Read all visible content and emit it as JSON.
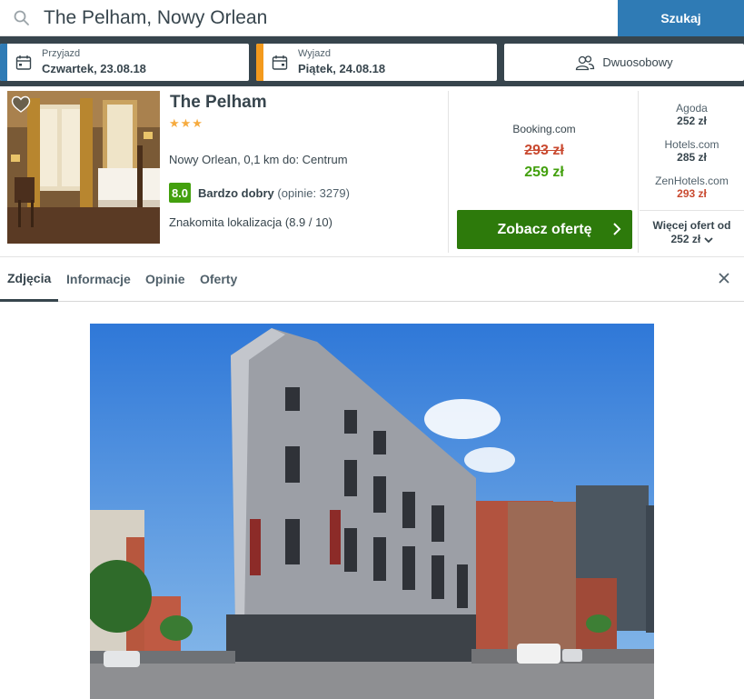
{
  "search": {
    "value": "The Pelham, Nowy Orlean",
    "button_label": "Szukaj"
  },
  "dates": {
    "checkin": {
      "label": "Przyjazd",
      "value": "Czwartek, 23.08.18",
      "accent": "#2f7bb5"
    },
    "checkout": {
      "label": "Wyjazd",
      "value": "Piątek, 24.08.18",
      "accent": "#f39a1d"
    },
    "rooms": {
      "label": "Dwuosobowy",
      "icon": "guests-icon"
    }
  },
  "hotel": {
    "name": "The Pelham",
    "stars": "★★★",
    "location": "Nowy Orlean, 0,1 km do: Centrum",
    "rating": {
      "score": "8.0",
      "label": "Bardzo dobry",
      "reviews": "(opinie: 3279)"
    },
    "location_score": "Znakomita lokalizacja (8.9 / 10)",
    "favorite_icon": "heart-icon"
  },
  "deal": {
    "provider": "Booking.com",
    "old_price": "293 zł",
    "price": "259 zł",
    "button_label": "Zobacz ofertę"
  },
  "other_deals": [
    {
      "provider": "Agoda",
      "price": "252 zł",
      "color": "#37454d"
    },
    {
      "provider": "Hotels.com",
      "price": "285 zł",
      "color": "#37454d"
    },
    {
      "provider": "ZenHotels.com",
      "price": "293 zł",
      "color": "#c94a30"
    }
  ],
  "more_offers": {
    "line1": "Więcej ofert od",
    "line2": "252 zł"
  },
  "tabs": [
    {
      "label": "Zdjęcia",
      "active": true
    },
    {
      "label": "Informacje",
      "active": false
    },
    {
      "label": "Opinie",
      "active": false
    },
    {
      "label": "Oferty",
      "active": false
    }
  ],
  "colors": {
    "brand_blue": "#2f7bb5",
    "cta_green": "#2d7a0b",
    "price_green": "#43a00e",
    "price_red": "#c94a30",
    "header_dark": "#37454d"
  }
}
